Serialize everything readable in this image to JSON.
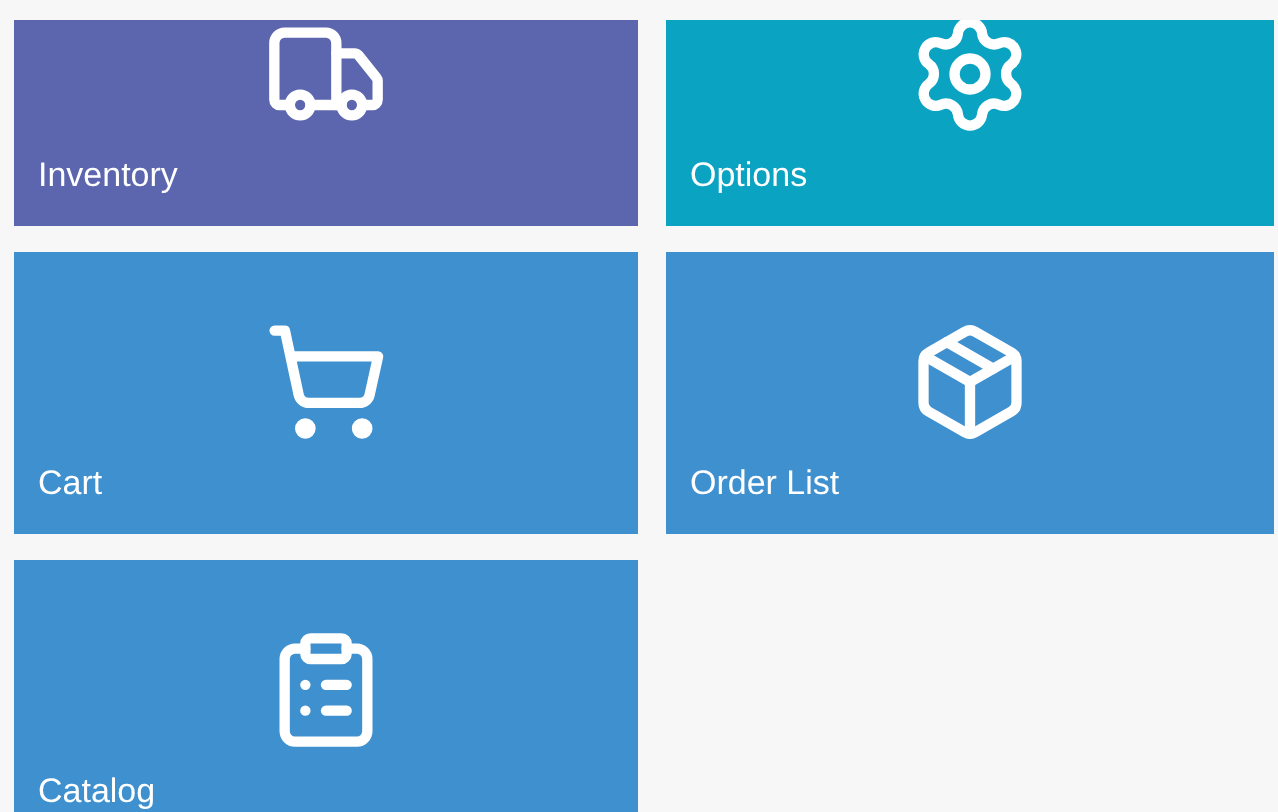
{
  "tiles": [
    {
      "label": "Inventory",
      "kind": "truck",
      "color": "#5b66ae"
    },
    {
      "label": "Options",
      "kind": "gear",
      "color": "#0aa3c2"
    },
    {
      "label": "Cart",
      "kind": "cart",
      "color": "#3f90cf"
    },
    {
      "label": "Order List",
      "kind": "box",
      "color": "#3f90cf"
    },
    {
      "label": "Catalog",
      "kind": "list",
      "color": "#3f90cf"
    }
  ]
}
